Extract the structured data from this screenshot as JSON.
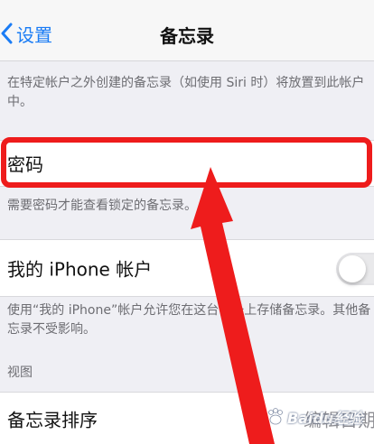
{
  "nav": {
    "back_label": "设置",
    "title": "备忘录"
  },
  "account_note": "在特定帐户之外创建的备忘录（如使用 Siri 时）将放置到此帐户中。",
  "password": {
    "label": "密码",
    "note": "需要密码才能查看锁定的备忘录。"
  },
  "my_iphone": {
    "label": "我的 iPhone 帐户",
    "toggle_on": false,
    "note": "使用“我的 iPhone”帐户允许您在这台设备上存储备忘录。其他备忘录不受影响。"
  },
  "view_section": {
    "header": "视图",
    "sort_label": "备忘录排序",
    "sort_value": "编辑日期"
  },
  "colors": {
    "accent": "#1a7cf5",
    "annotation": "#ee1c1c"
  },
  "watermark": "Baidu经验"
}
